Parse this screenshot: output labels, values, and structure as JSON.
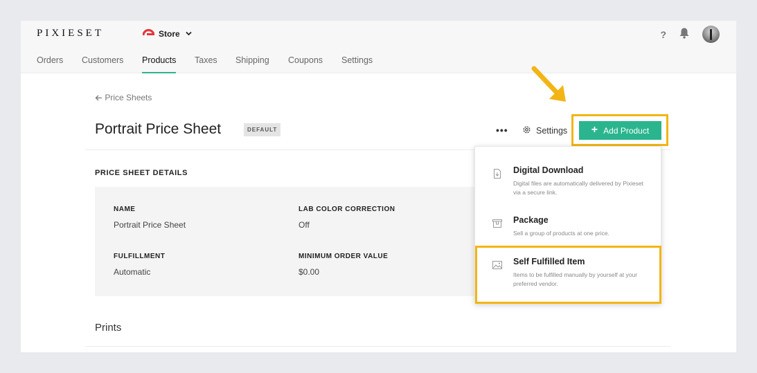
{
  "app": {
    "logo": "PIXIESET",
    "store_label": "Store",
    "help_label": "?"
  },
  "nav": {
    "items": [
      {
        "label": "Orders",
        "active": false
      },
      {
        "label": "Customers",
        "active": false
      },
      {
        "label": "Products",
        "active": true
      },
      {
        "label": "Taxes",
        "active": false
      },
      {
        "label": "Shipping",
        "active": false
      },
      {
        "label": "Coupons",
        "active": false
      },
      {
        "label": "Settings",
        "active": false
      }
    ]
  },
  "page": {
    "back_label": "Price Sheets",
    "title": "Portrait Price Sheet",
    "badge": "DEFAULT",
    "more_label": "•••",
    "settings_label": "Settings",
    "add_product_label": "Add Product"
  },
  "details": {
    "section_title": "PRICE SHEET DETAILS",
    "fields": [
      {
        "label": "NAME",
        "value": "Portrait Price Sheet"
      },
      {
        "label": "LAB COLOR CORRECTION",
        "value": "Off"
      },
      {
        "label": "FULFILLMENT",
        "value": "Automatic"
      },
      {
        "label": "MINIMUM ORDER VALUE",
        "value": "$0.00"
      }
    ]
  },
  "prints_title": "Prints",
  "dropdown": {
    "items": [
      {
        "title": "Digital Download",
        "description": "Digital files are automatically delivered by Pixieset via a secure link.",
        "icon": "file-download-icon"
      },
      {
        "title": "Package",
        "description": "Sell a group of products at one price.",
        "icon": "package-box-icon"
      },
      {
        "title": "Self Fulfilled Item",
        "description": "Items to be fulfilled manually by yourself at your preferred vendor.",
        "icon": "image-icon"
      }
    ]
  },
  "colors": {
    "accent": "#2bb58f",
    "highlight": "#f3b515",
    "brand_red": "#e8353a"
  }
}
